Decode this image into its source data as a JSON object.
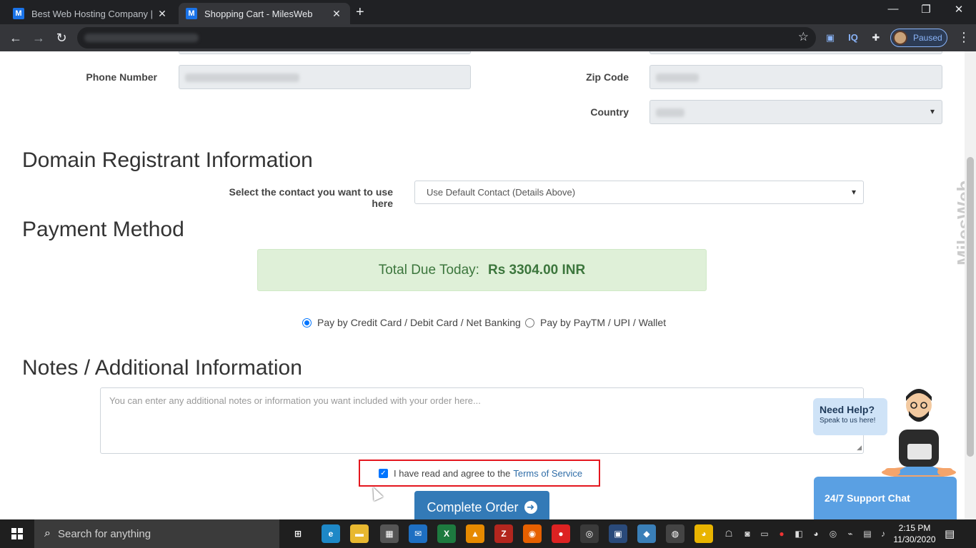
{
  "browser": {
    "tabs": [
      {
        "title": "Best Web Hosting Company | Ch",
        "favicon": "M",
        "active": false
      },
      {
        "title": "Shopping Cart - MilesWeb",
        "favicon": "M",
        "active": true
      }
    ],
    "new_tab_icon": "+",
    "profile_status": "Paused",
    "extension_iq": "IQ"
  },
  "form": {
    "phone_label": "Phone Number",
    "zip_label": "Zip Code",
    "country_label": "Country"
  },
  "domain_registrant": {
    "heading": "Domain Registrant Information",
    "select_label": "Select the contact you want to use here",
    "select_value": "Use Default Contact (Details Above)"
  },
  "payment": {
    "heading": "Payment Method",
    "total_label": "Total Due Today:",
    "total_value": "Rs 3304.00 INR",
    "options": [
      {
        "label": "Pay by Credit Card / Debit Card / Net Banking",
        "checked": true
      },
      {
        "label": "Pay by PayTM / UPI / Wallet",
        "checked": false
      }
    ]
  },
  "notes": {
    "heading": "Notes / Additional Information",
    "placeholder": "You can enter any additional notes or information you want included with your order here..."
  },
  "tos": {
    "text": "I have read and agree to the",
    "link": "Terms of Service",
    "checked": true
  },
  "complete_button": "Complete Order",
  "chat": {
    "bubble_title": "Need Help?",
    "bubble_sub": "Speak to us here!",
    "button": "24/7 Support Chat"
  },
  "watermark": "MilesWeb",
  "taskbar": {
    "search_placeholder": "Search for anything",
    "time": "2:15 PM",
    "date": "11/30/2020"
  },
  "colors": {
    "accent": "#337ab7",
    "success_bg": "#dff0d8",
    "success_text": "#3c763d",
    "highlight": "#e4161e"
  }
}
